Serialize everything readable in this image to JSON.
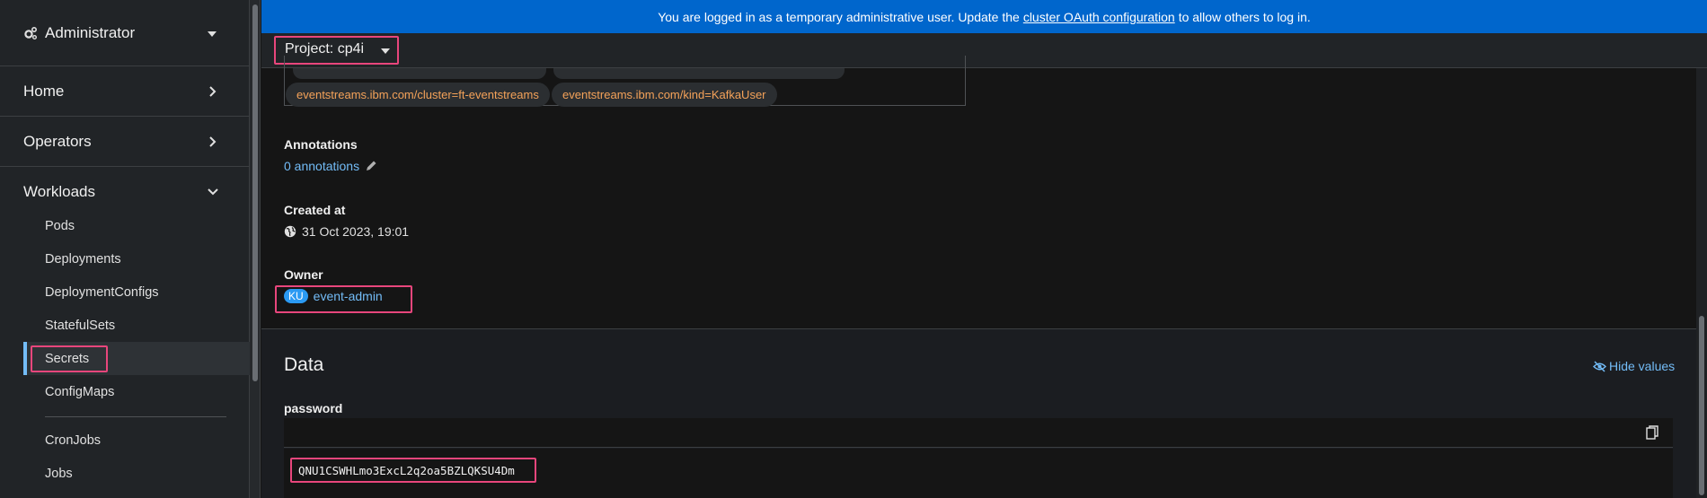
{
  "banner": {
    "prefix": "You are logged in as a temporary administrative user. Update the",
    "link": "cluster OAuth configuration",
    "suffix": "to allow others to log in."
  },
  "sidebar": {
    "perspective": "Administrator",
    "sections": [
      {
        "label": "Home",
        "state": "collapsed"
      },
      {
        "label": "Operators",
        "state": "collapsed"
      },
      {
        "label": "Workloads",
        "state": "expanded"
      }
    ],
    "workload_items": [
      "Pods",
      "Deployments",
      "DeploymentConfigs",
      "StatefulSets",
      "Secrets",
      "ConfigMaps",
      "CronJobs",
      "Jobs"
    ],
    "active_item": "Secrets"
  },
  "project_bar": {
    "label": "Project: cp4i"
  },
  "labels": {
    "chips": [
      "eventstreams.ibm.com/cluster=ft-eventstreams",
      "eventstreams.ibm.com/kind=KafkaUser"
    ]
  },
  "details": {
    "annotations_label": "Annotations",
    "annotations_value": "0 annotations",
    "created_label": "Created at",
    "created_value": "31 Oct 2023, 19:01",
    "owner_label": "Owner",
    "owner_badge": "KU",
    "owner_value": "event-admin"
  },
  "data_section": {
    "title": "Data",
    "hide_values": "Hide values",
    "key": "password",
    "value": "QNU1CSWHLmo3ExcL2q2oa5BZLQKSU4Dm"
  },
  "colors": {
    "banner_bg": "#0066cc",
    "link": "#73bcf7",
    "label_chip_text": "#f4a259",
    "highlight": "#e8467c",
    "active_indicator": "#73bcf7"
  }
}
